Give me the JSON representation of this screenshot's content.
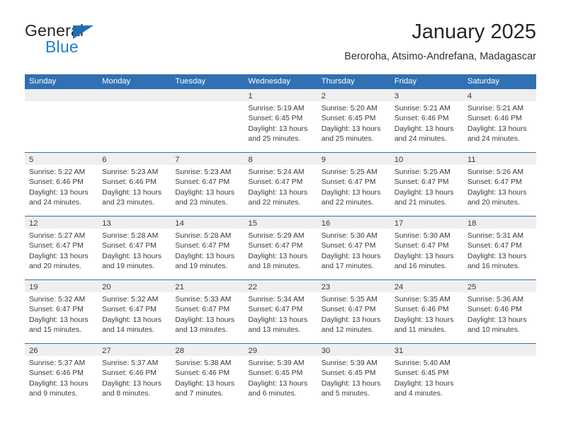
{
  "brand": {
    "name_part1": "General",
    "name_part2": "Blue",
    "triangle_icon": "triangle-icon",
    "accent_dark": "#1f6fb5",
    "accent_light": "#2080cf"
  },
  "header": {
    "title": "January 2025",
    "subtitle": "Beroroha, Atsimo-Andrefana, Madagascar"
  },
  "theme": {
    "header_blue": "#3170b3",
    "day_strip_gray": "#efefef",
    "text": "#3a3a3a"
  },
  "weekdays": [
    "Sunday",
    "Monday",
    "Tuesday",
    "Wednesday",
    "Thursday",
    "Friday",
    "Saturday"
  ],
  "weeks": [
    [
      {
        "day": "",
        "empty": true,
        "sunrise": "",
        "sunset": "",
        "daylight_1": "",
        "daylight_2": ""
      },
      {
        "day": "",
        "empty": true,
        "sunrise": "",
        "sunset": "",
        "daylight_1": "",
        "daylight_2": ""
      },
      {
        "day": "",
        "empty": true,
        "sunrise": "",
        "sunset": "",
        "daylight_1": "",
        "daylight_2": ""
      },
      {
        "day": "1",
        "empty": false,
        "sunrise": "Sunrise: 5:19 AM",
        "sunset": "Sunset: 6:45 PM",
        "daylight_1": "Daylight: 13 hours",
        "daylight_2": "and 25 minutes."
      },
      {
        "day": "2",
        "empty": false,
        "sunrise": "Sunrise: 5:20 AM",
        "sunset": "Sunset: 6:45 PM",
        "daylight_1": "Daylight: 13 hours",
        "daylight_2": "and 25 minutes."
      },
      {
        "day": "3",
        "empty": false,
        "sunrise": "Sunrise: 5:21 AM",
        "sunset": "Sunset: 6:46 PM",
        "daylight_1": "Daylight: 13 hours",
        "daylight_2": "and 24 minutes."
      },
      {
        "day": "4",
        "empty": false,
        "sunrise": "Sunrise: 5:21 AM",
        "sunset": "Sunset: 6:46 PM",
        "daylight_1": "Daylight: 13 hours",
        "daylight_2": "and 24 minutes."
      }
    ],
    [
      {
        "day": "5",
        "empty": false,
        "sunrise": "Sunrise: 5:22 AM",
        "sunset": "Sunset: 6:46 PM",
        "daylight_1": "Daylight: 13 hours",
        "daylight_2": "and 24 minutes."
      },
      {
        "day": "6",
        "empty": false,
        "sunrise": "Sunrise: 5:23 AM",
        "sunset": "Sunset: 6:46 PM",
        "daylight_1": "Daylight: 13 hours",
        "daylight_2": "and 23 minutes."
      },
      {
        "day": "7",
        "empty": false,
        "sunrise": "Sunrise: 5:23 AM",
        "sunset": "Sunset: 6:47 PM",
        "daylight_1": "Daylight: 13 hours",
        "daylight_2": "and 23 minutes."
      },
      {
        "day": "8",
        "empty": false,
        "sunrise": "Sunrise: 5:24 AM",
        "sunset": "Sunset: 6:47 PM",
        "daylight_1": "Daylight: 13 hours",
        "daylight_2": "and 22 minutes."
      },
      {
        "day": "9",
        "empty": false,
        "sunrise": "Sunrise: 5:25 AM",
        "sunset": "Sunset: 6:47 PM",
        "daylight_1": "Daylight: 13 hours",
        "daylight_2": "and 22 minutes."
      },
      {
        "day": "10",
        "empty": false,
        "sunrise": "Sunrise: 5:25 AM",
        "sunset": "Sunset: 6:47 PM",
        "daylight_1": "Daylight: 13 hours",
        "daylight_2": "and 21 minutes."
      },
      {
        "day": "11",
        "empty": false,
        "sunrise": "Sunrise: 5:26 AM",
        "sunset": "Sunset: 6:47 PM",
        "daylight_1": "Daylight: 13 hours",
        "daylight_2": "and 20 minutes."
      }
    ],
    [
      {
        "day": "12",
        "empty": false,
        "sunrise": "Sunrise: 5:27 AM",
        "sunset": "Sunset: 6:47 PM",
        "daylight_1": "Daylight: 13 hours",
        "daylight_2": "and 20 minutes."
      },
      {
        "day": "13",
        "empty": false,
        "sunrise": "Sunrise: 5:28 AM",
        "sunset": "Sunset: 6:47 PM",
        "daylight_1": "Daylight: 13 hours",
        "daylight_2": "and 19 minutes."
      },
      {
        "day": "14",
        "empty": false,
        "sunrise": "Sunrise: 5:28 AM",
        "sunset": "Sunset: 6:47 PM",
        "daylight_1": "Daylight: 13 hours",
        "daylight_2": "and 19 minutes."
      },
      {
        "day": "15",
        "empty": false,
        "sunrise": "Sunrise: 5:29 AM",
        "sunset": "Sunset: 6:47 PM",
        "daylight_1": "Daylight: 13 hours",
        "daylight_2": "and 18 minutes."
      },
      {
        "day": "16",
        "empty": false,
        "sunrise": "Sunrise: 5:30 AM",
        "sunset": "Sunset: 6:47 PM",
        "daylight_1": "Daylight: 13 hours",
        "daylight_2": "and 17 minutes."
      },
      {
        "day": "17",
        "empty": false,
        "sunrise": "Sunrise: 5:30 AM",
        "sunset": "Sunset: 6:47 PM",
        "daylight_1": "Daylight: 13 hours",
        "daylight_2": "and 16 minutes."
      },
      {
        "day": "18",
        "empty": false,
        "sunrise": "Sunrise: 5:31 AM",
        "sunset": "Sunset: 6:47 PM",
        "daylight_1": "Daylight: 13 hours",
        "daylight_2": "and 16 minutes."
      }
    ],
    [
      {
        "day": "19",
        "empty": false,
        "sunrise": "Sunrise: 5:32 AM",
        "sunset": "Sunset: 6:47 PM",
        "daylight_1": "Daylight: 13 hours",
        "daylight_2": "and 15 minutes."
      },
      {
        "day": "20",
        "empty": false,
        "sunrise": "Sunrise: 5:32 AM",
        "sunset": "Sunset: 6:47 PM",
        "daylight_1": "Daylight: 13 hours",
        "daylight_2": "and 14 minutes."
      },
      {
        "day": "21",
        "empty": false,
        "sunrise": "Sunrise: 5:33 AM",
        "sunset": "Sunset: 6:47 PM",
        "daylight_1": "Daylight: 13 hours",
        "daylight_2": "and 13 minutes."
      },
      {
        "day": "22",
        "empty": false,
        "sunrise": "Sunrise: 5:34 AM",
        "sunset": "Sunset: 6:47 PM",
        "daylight_1": "Daylight: 13 hours",
        "daylight_2": "and 13 minutes."
      },
      {
        "day": "23",
        "empty": false,
        "sunrise": "Sunrise: 5:35 AM",
        "sunset": "Sunset: 6:47 PM",
        "daylight_1": "Daylight: 13 hours",
        "daylight_2": "and 12 minutes."
      },
      {
        "day": "24",
        "empty": false,
        "sunrise": "Sunrise: 5:35 AM",
        "sunset": "Sunset: 6:46 PM",
        "daylight_1": "Daylight: 13 hours",
        "daylight_2": "and 11 minutes."
      },
      {
        "day": "25",
        "empty": false,
        "sunrise": "Sunrise: 5:36 AM",
        "sunset": "Sunset: 6:46 PM",
        "daylight_1": "Daylight: 13 hours",
        "daylight_2": "and 10 minutes."
      }
    ],
    [
      {
        "day": "26",
        "empty": false,
        "sunrise": "Sunrise: 5:37 AM",
        "sunset": "Sunset: 6:46 PM",
        "daylight_1": "Daylight: 13 hours",
        "daylight_2": "and 9 minutes."
      },
      {
        "day": "27",
        "empty": false,
        "sunrise": "Sunrise: 5:37 AM",
        "sunset": "Sunset: 6:46 PM",
        "daylight_1": "Daylight: 13 hours",
        "daylight_2": "and 8 minutes."
      },
      {
        "day": "28",
        "empty": false,
        "sunrise": "Sunrise: 5:38 AM",
        "sunset": "Sunset: 6:46 PM",
        "daylight_1": "Daylight: 13 hours",
        "daylight_2": "and 7 minutes."
      },
      {
        "day": "29",
        "empty": false,
        "sunrise": "Sunrise: 5:39 AM",
        "sunset": "Sunset: 6:45 PM",
        "daylight_1": "Daylight: 13 hours",
        "daylight_2": "and 6 minutes."
      },
      {
        "day": "30",
        "empty": false,
        "sunrise": "Sunrise: 5:39 AM",
        "sunset": "Sunset: 6:45 PM",
        "daylight_1": "Daylight: 13 hours",
        "daylight_2": "and 5 minutes."
      },
      {
        "day": "31",
        "empty": false,
        "sunrise": "Sunrise: 5:40 AM",
        "sunset": "Sunset: 6:45 PM",
        "daylight_1": "Daylight: 13 hours",
        "daylight_2": "and 4 minutes."
      },
      {
        "day": "",
        "empty": true,
        "sunrise": "",
        "sunset": "",
        "daylight_1": "",
        "daylight_2": ""
      }
    ]
  ]
}
